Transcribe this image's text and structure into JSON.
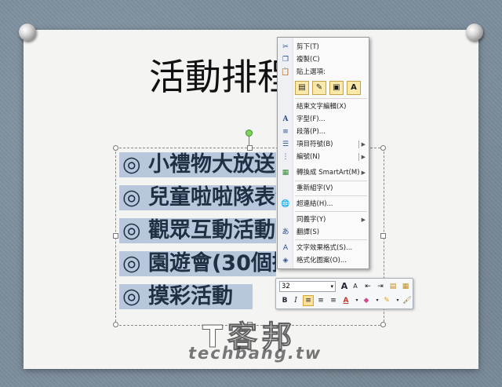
{
  "slide": {
    "title": "活動排程"
  },
  "bullets": [
    "◎ 小禮物大放送",
    "◎ 兒童啦啦隊表演",
    "◎ 觀眾互動活動",
    "◎ 園遊會(30個攤位)",
    "◎ 摸彩活動"
  ],
  "context_menu": {
    "cut": "剪下(T)",
    "copy": "複製(C)",
    "paste_options": "貼上選項:",
    "paste_buttons": [
      "A"
    ],
    "exit_edit": "結束文字編輯(X)",
    "font": "字型(F)...",
    "paragraph": "段落(P)...",
    "bullets": "項目符號(B)",
    "numbering": "編號(N)",
    "smartart": "轉換成 SmartArt(M)",
    "reconvert": "重新組字(V)",
    "hyperlink": "超連結(H)...",
    "synonyms": "同義字(Y)",
    "translate": "翻譯(S)",
    "text_effects": "文字效果格式(S)...",
    "format_shape": "格式化圖案(O)..."
  },
  "mini_toolbar": {
    "font_size": "32",
    "bold": "B",
    "italic": "I",
    "grow": "A",
    "shrink": "A"
  },
  "watermark": {
    "cn": "T客邦",
    "en": "techbang.tw"
  },
  "colors": {
    "accent_highlight": "#fbe09a",
    "selection": "#b8c7dc",
    "rotate_handle": "#7bd65a",
    "font_color": "#c0392b"
  }
}
